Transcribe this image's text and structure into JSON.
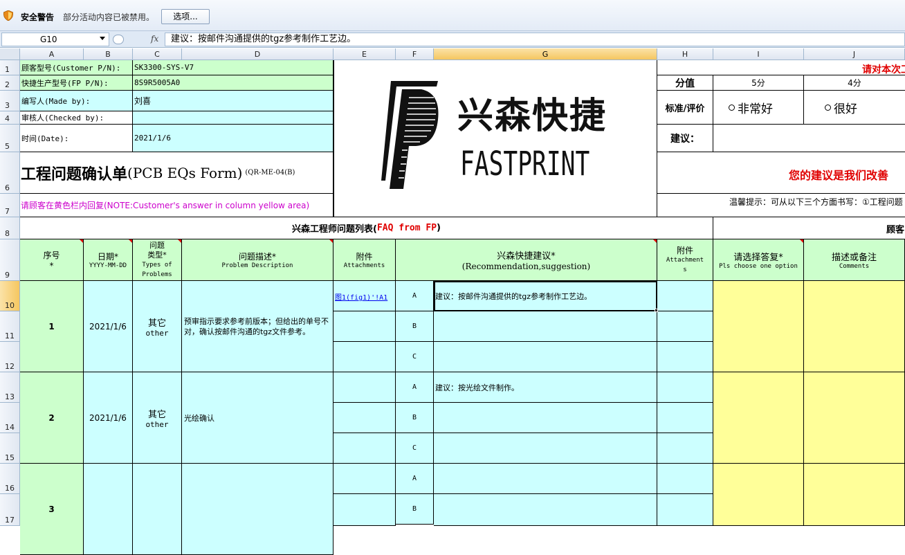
{
  "security_bar": {
    "title": "安全警告",
    "message": "部分活动内容已被禁用。",
    "options_button": "选项..."
  },
  "formula_bar": {
    "name_box": "G10",
    "fx": "fx",
    "formula": "建议：按邮件沟通提供的tgz参考制作工艺边。"
  },
  "columns": [
    "A",
    "B",
    "C",
    "D",
    "E",
    "F",
    "G",
    "H",
    "I",
    "J"
  ],
  "rows": [
    "1",
    "2",
    "3",
    "4",
    "5",
    "6",
    "7",
    "8",
    "9",
    "10",
    "11",
    "12",
    "13",
    "14",
    "15",
    "16",
    "17"
  ],
  "header_info": {
    "customer_pn_label": "顾客型号(Customer P/N):",
    "customer_pn": "SK3300-SYS-V7",
    "fp_pn_label": "快捷生产型号(FP P/N):",
    "fp_pn": "8S9R5005A0",
    "made_by_label": "编写人(Made by):",
    "made_by": "刘喜",
    "checked_by_label": "审核人(Checked by):",
    "checked_by": "",
    "date_label": "时间(Date):",
    "date": "2021/1/6",
    "form_title": "工程问题确认单",
    "form_title_en": "(PCB EQs Form)",
    "form_code": "(QR-ME-04(B)",
    "note": "请顾客在黄色栏内回复(NOTE:Customer's answer in column yellow area)"
  },
  "logo": {
    "cn": "兴森快捷",
    "en": "FASTPRINT"
  },
  "rating": {
    "banner": "请对本次工",
    "score_label": "分值",
    "score_5": "5分",
    "score_4": "4分",
    "std_label": "标准/评价",
    "opt_5": "非常好",
    "opt_4": "很好",
    "suggest_label": "建议：",
    "suggest_banner": "您的建议是我们改善",
    "tip": "温馨提示：可从以下三个方面书写：①工程问题"
  },
  "faq_title_a": "兴森工程师问题列表(",
  "faq_title_b": "FAQ from FP",
  "faq_title_c": ")",
  "customer_title": "顾客",
  "table_headers": {
    "seq": "序号",
    "seq_star": "*",
    "date": "日期*",
    "date_fmt": "YYYY-MM-DD",
    "type1": "问题",
    "type2": "类型*",
    "type3": "Types of",
    "type4": "Problems",
    "desc": "问题描述*",
    "desc_en": "Problem Description",
    "attach": "附件",
    "attach_en": "Attachments",
    "rec": "兴森快捷建议*",
    "rec_en": "(Recommendation,suggestion)",
    "attach2": "附件",
    "attach2_en1": "Attachment",
    "attach2_en2": "s",
    "reply": "请选择答复*",
    "reply_en": "Pls choose one option",
    "comments": "描述或备注",
    "comments_en": "Comments"
  },
  "issues": [
    {
      "seq": "1",
      "date": "2021/1/6",
      "type": "其它",
      "type_en": "other",
      "desc": "预审指示要求参考前版本；但给出的单号不对，确认按邮件沟通的tgz文件参考。",
      "attachment": "图1(fig1)'!A1",
      "options": [
        {
          "key": "A",
          "text": "建议：按邮件沟通提供的tgz参考制作工艺边。"
        },
        {
          "key": "B",
          "text": ""
        },
        {
          "key": "C",
          "text": ""
        }
      ]
    },
    {
      "seq": "2",
      "date": "2021/1/6",
      "type": "其它",
      "type_en": "other",
      "desc": "光绘确认",
      "attachment": "",
      "options": [
        {
          "key": "A",
          "text": "建议：按光绘文件制作。"
        },
        {
          "key": "B",
          "text": ""
        },
        {
          "key": "C",
          "text": ""
        }
      ]
    },
    {
      "seq": "3",
      "date": "",
      "type": "",
      "type_en": "",
      "desc": "",
      "attachment": "",
      "options": [
        {
          "key": "A",
          "text": ""
        },
        {
          "key": "B",
          "text": ""
        }
      ]
    }
  ]
}
